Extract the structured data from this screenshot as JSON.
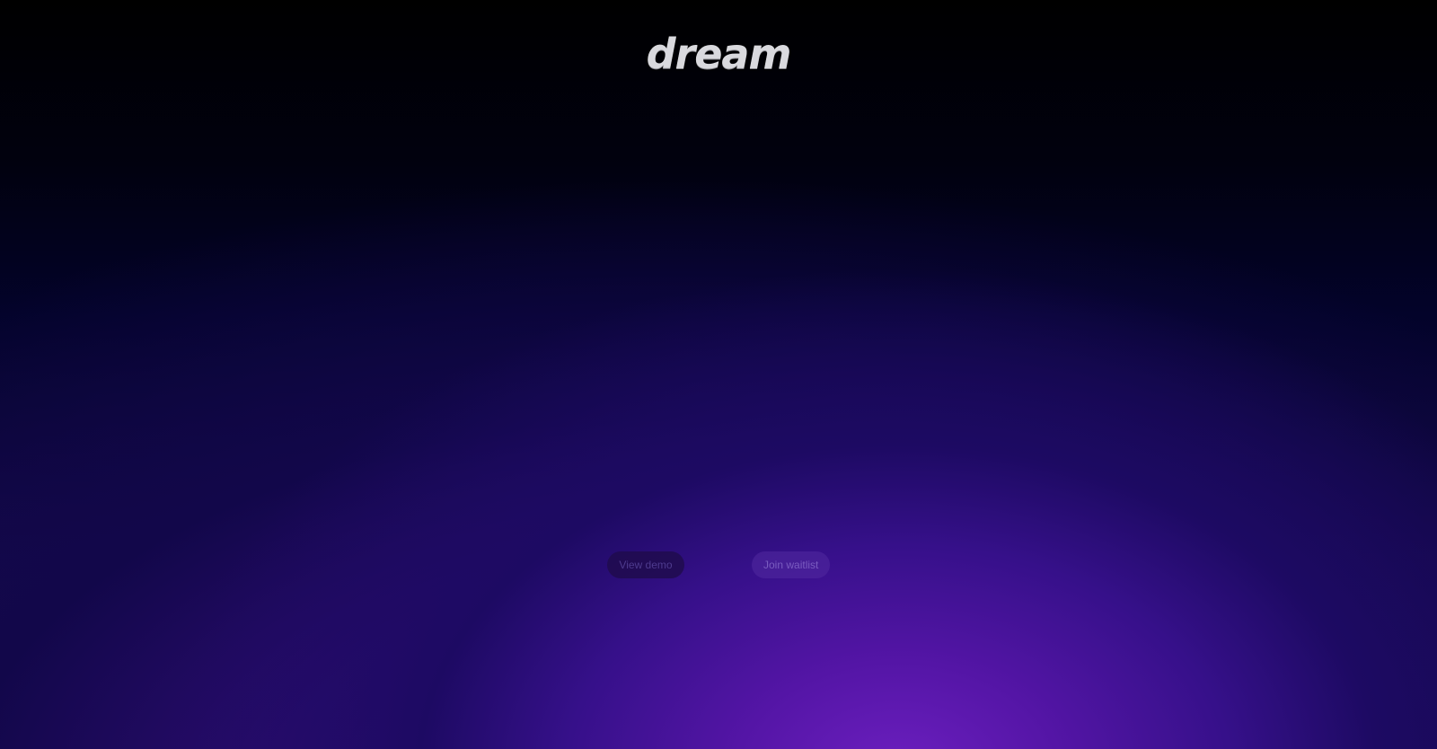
{
  "header": {
    "logo_text": "dream"
  },
  "hero": {
    "buttons": {
      "view_demo_label": "View demo",
      "join_waitlist_label": "Join waitlist"
    }
  },
  "colors": {
    "background_top": "#000000",
    "glow_center": "#6c1fbf",
    "glow_mid": "#36108a",
    "logo_text": "#d9d9de",
    "view_demo_bg": "#200c4e",
    "join_waitlist_bg": "#522aa0"
  }
}
